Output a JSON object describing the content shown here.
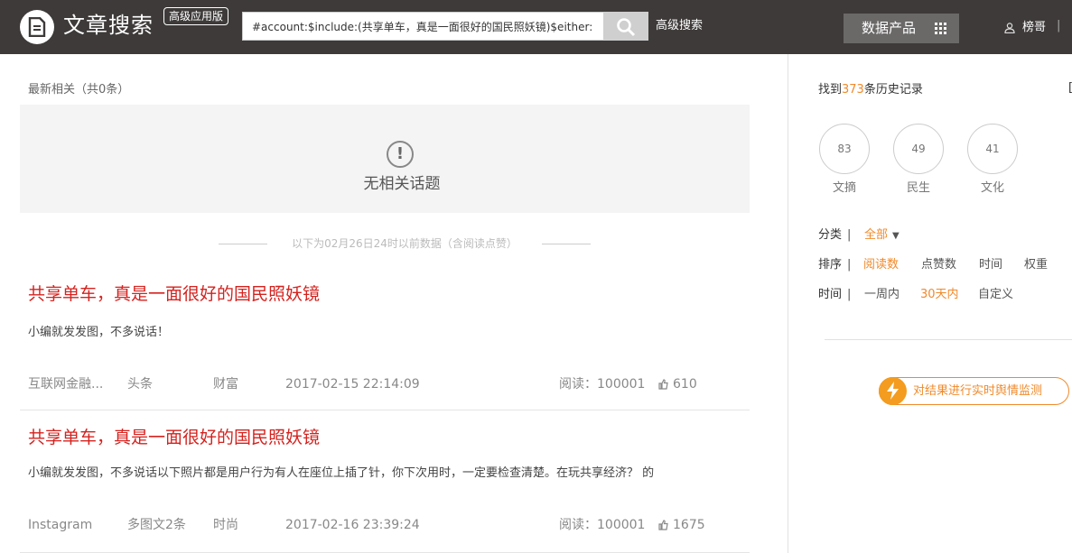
{
  "header": {
    "brand": "文章搜索",
    "badge": "高级应用版",
    "search_value": "#account:$include:(共享单车，真是一面很好的国民照妖镜)$either:",
    "advanced_search": "高级搜索",
    "data_product": "数据产品",
    "user_name": "榜哥",
    "user_sep": "|"
  },
  "main": {
    "section_title": "最新相关（共0条）",
    "empty_icon": "!",
    "empty_text": "无相关话题",
    "divider_note": "以下为02月26日24时以前数据（含阅读点赞）",
    "articles": [
      {
        "title": "共享单车，真是一面很好的国民照妖镜",
        "summary": "小编就发发图，不多说话！",
        "account": "互联网金融...",
        "position": "头条",
        "category": "财富",
        "time": "2017-02-15 22:14:09",
        "reads": "阅读：100001",
        "likes": "610"
      },
      {
        "title": "共享单车，真是一面很好的国民照妖镜",
        "summary": "小编就发发图，不多说话以下照片都是用户行为有人在座位上插了针，你下次用时，一定要检查清楚。在玩共享经济？ 的",
        "account": "Instagram",
        "position": "多图文2条",
        "category": "时尚",
        "time": "2017-02-16 23:39:24",
        "reads": "阅读：100001",
        "likes": "1675"
      }
    ]
  },
  "sidebar": {
    "found_prefix": "找到",
    "found_count": "373",
    "found_suffix": "条历史记录",
    "edge_bracket": "[",
    "categories": [
      {
        "count": "83",
        "label": "文摘"
      },
      {
        "count": "49",
        "label": "民生"
      },
      {
        "count": "41",
        "label": "文化"
      }
    ],
    "filter_category": {
      "label": "分类",
      "sep": "|",
      "value": "全部",
      "caret": "▼"
    },
    "filter_sort": {
      "label": "排序",
      "sep": "|",
      "options": [
        "阅读数",
        "点赞数",
        "时间",
        "权重"
      ]
    },
    "filter_time": {
      "label": "时间",
      "sep": "|",
      "options": [
        "一周内",
        "30天内",
        "自定义"
      ]
    },
    "monitor_button": "对结果进行实时舆情监测"
  },
  "colors": {
    "topbar": "#3d3a39",
    "accent": "#f08a2b",
    "title_red": "#d4231f"
  },
  "icons": [
    "document-icon",
    "search-icon",
    "grid-icon",
    "user-icon",
    "warning-icon",
    "thumbs-up-icon",
    "lightning-icon"
  ]
}
